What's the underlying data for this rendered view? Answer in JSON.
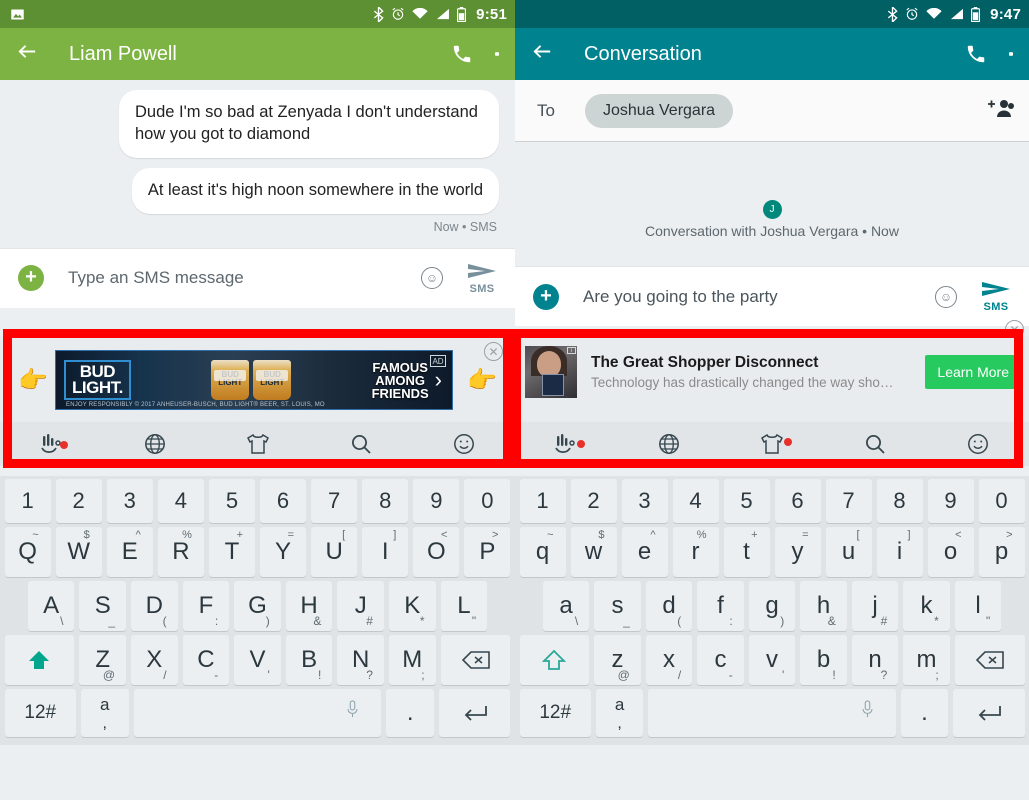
{
  "left": {
    "statusbar": {
      "time": "9:51",
      "icons": [
        "image-icon",
        "bluetooth-icon",
        "alarm-icon",
        "wifi-icon",
        "signal-icon",
        "battery-icon"
      ]
    },
    "appbar": {
      "title": "Liam Powell",
      "back": "back-arrow",
      "call": "phone-icon",
      "overflow": "more-options"
    },
    "messages": [
      {
        "text": "Dude I'm so bad at Zenyada I don't understand how you got to diamond"
      },
      {
        "text": "At least it's high noon somewhere in the world"
      }
    ],
    "meta": "Now • SMS",
    "compose": {
      "placeholder": "Type an SMS message",
      "value": "",
      "send_label": "SMS",
      "attach": "+"
    },
    "ad": {
      "brand_line1": "BUD",
      "brand_line2": "LIGHT.",
      "headline_1": "FAMOUS",
      "headline_2": "AMONG",
      "headline_3": "FRIENDS",
      "glass_label": "BUD LIGHT",
      "legal": "ENJOY RESPONSIBLY © 2017 ANHEUSER-BUSCH, BUD LIGHT® BEER, ST. LOUIS, MO",
      "adchoices": "AD",
      "chevron": "›",
      "close": "✕"
    },
    "keyboard": {
      "toolbar": [
        "touchpal-icon",
        "globe-icon",
        "tshirt-icon",
        "search-icon",
        "emoji-icon"
      ],
      "row_numbers": [
        "1",
        "2",
        "3",
        "4",
        "5",
        "6",
        "7",
        "8",
        "9",
        "0"
      ],
      "row1": [
        {
          "main": "Q",
          "sup": "~"
        },
        {
          "main": "W",
          "sup": "$"
        },
        {
          "main": "E",
          "sup": "^"
        },
        {
          "main": "R",
          "sup": "%"
        },
        {
          "main": "T",
          "sup": "+"
        },
        {
          "main": "Y",
          "sup": "="
        },
        {
          "main": "U",
          "sup": "["
        },
        {
          "main": "I",
          "sup": "]"
        },
        {
          "main": "O",
          "sup": "<"
        },
        {
          "main": "P",
          "sup": ">"
        }
      ],
      "row2": [
        {
          "main": "A",
          "sub": "\\"
        },
        {
          "main": "S",
          "sub": "_"
        },
        {
          "main": "D",
          "sub": "("
        },
        {
          "main": "F",
          "sub": ":"
        },
        {
          "main": "G",
          "sub": ")"
        },
        {
          "main": "H",
          "sub": "&"
        },
        {
          "main": "J",
          "sub": "#"
        },
        {
          "main": "K",
          "sub": "*"
        },
        {
          "main": "L",
          "sub": "\""
        }
      ],
      "row3": [
        {
          "main": "Z",
          "sub": "@"
        },
        {
          "main": "X",
          "sub": "/"
        },
        {
          "main": "C",
          "sub": "-"
        },
        {
          "main": "V",
          "sub": "'"
        },
        {
          "main": "B",
          "sub": "!"
        },
        {
          "main": "N",
          "sub": "?"
        },
        {
          "main": "M",
          "sub": ";"
        }
      ],
      "shift": "shift-icon",
      "backspace": "backspace-icon",
      "bottom": {
        "numsym": "12#",
        "lang_main": "a",
        "lang_sub": ",",
        "space": "",
        "period": ".",
        "enter": "enter-icon",
        "mic": "mic-icon"
      }
    }
  },
  "right": {
    "statusbar": {
      "time": "9:47",
      "icons": [
        "bluetooth-icon",
        "alarm-icon",
        "wifi-icon",
        "signal-icon",
        "battery-icon"
      ]
    },
    "appbar": {
      "title": "Conversation",
      "back": "back-arrow",
      "call": "phone-icon",
      "overflow": "more-options"
    },
    "tobar": {
      "label": "To",
      "chip": "Joshua Vergara",
      "add": "add-people-icon"
    },
    "convo_note": "Conversation with Joshua Vergara • Now",
    "avatar_initial": "J",
    "compose": {
      "placeholder": "",
      "value": "Are you going to the party",
      "send_label": "SMS",
      "attach": "+"
    },
    "ad": {
      "title": "The Great Shopper Disconnect",
      "subtitle": "Technology has drastically changed the way sho…",
      "cta": "Learn More",
      "close": "✕"
    },
    "keyboard": {
      "toolbar": [
        "touchpal-icon",
        "globe-icon",
        "tshirt-icon",
        "search-icon",
        "emoji-icon"
      ],
      "row_numbers": [
        "1",
        "2",
        "3",
        "4",
        "5",
        "6",
        "7",
        "8",
        "9",
        "0"
      ],
      "row1": [
        {
          "main": "q",
          "sup": "~"
        },
        {
          "main": "w",
          "sup": "$"
        },
        {
          "main": "e",
          "sup": "^"
        },
        {
          "main": "r",
          "sup": "%"
        },
        {
          "main": "t",
          "sup": "+"
        },
        {
          "main": "y",
          "sup": "="
        },
        {
          "main": "u",
          "sup": "["
        },
        {
          "main": "i",
          "sup": "]"
        },
        {
          "main": "o",
          "sup": "<"
        },
        {
          "main": "p",
          "sup": ">"
        }
      ],
      "row2": [
        {
          "main": "a",
          "sub": "\\"
        },
        {
          "main": "s",
          "sub": "_"
        },
        {
          "main": "d",
          "sub": "("
        },
        {
          "main": "f",
          "sub": ":"
        },
        {
          "main": "g",
          "sub": ")"
        },
        {
          "main": "h",
          "sub": "&"
        },
        {
          "main": "j",
          "sub": "#"
        },
        {
          "main": "k",
          "sub": "*"
        },
        {
          "main": "l",
          "sub": "\""
        }
      ],
      "row3": [
        {
          "main": "z",
          "sub": "@"
        },
        {
          "main": "x",
          "sub": "/"
        },
        {
          "main": "c",
          "sub": "-"
        },
        {
          "main": "v",
          "sub": "'"
        },
        {
          "main": "b",
          "sub": "!"
        },
        {
          "main": "n",
          "sub": "?"
        },
        {
          "main": "m",
          "sub": ";"
        }
      ],
      "shift": "shift-icon",
      "backspace": "backspace-icon",
      "bottom": {
        "numsym": "12#",
        "lang_main": "a",
        "lang_sub": ",",
        "space": "",
        "period": ".",
        "enter": "enter-icon",
        "mic": "mic-icon"
      }
    }
  },
  "colors": {
    "left_appbar": "#7cb342",
    "left_status": "#5d8f33",
    "right_appbar": "#00838f",
    "right_status": "#006064",
    "highlight": "#ff0000",
    "cta_green": "#27ca5f",
    "accent_teal": "#00897b"
  }
}
